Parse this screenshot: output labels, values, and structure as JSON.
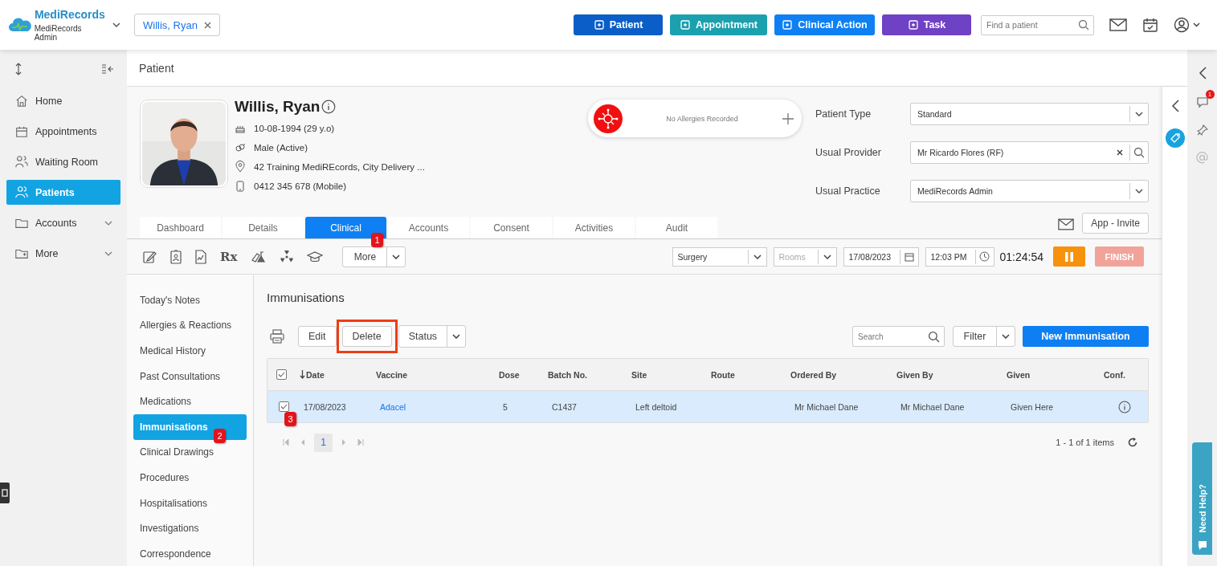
{
  "app": {
    "name": "MediRecords",
    "subtitle": "MediRecords Admin"
  },
  "open_patient": {
    "label": "Willis, Ryan"
  },
  "actions": [
    {
      "label": "Patient",
      "color": "#0b5ec7"
    },
    {
      "label": "Appointment",
      "color": "#1ba0ae"
    },
    {
      "label": "Clinical Action",
      "color": "#0e80f3"
    },
    {
      "label": "Task",
      "color": "#6f41c4"
    }
  ],
  "patient_search": {
    "placeholder": "Find a patient"
  },
  "sidebar": {
    "items": [
      {
        "label": "Home",
        "selected": false,
        "has_submenu": false
      },
      {
        "label": "Appointments",
        "selected": false,
        "has_submenu": false
      },
      {
        "label": "Waiting Room",
        "selected": false,
        "has_submenu": false
      },
      {
        "label": "Patients",
        "selected": true,
        "has_submenu": false
      },
      {
        "label": "Accounts",
        "selected": false,
        "has_submenu": true
      },
      {
        "label": "More",
        "selected": false,
        "has_submenu": true
      }
    ]
  },
  "page_title": "Patient",
  "patient": {
    "name": "Willis, Ryan",
    "dob": "10-08-1994 (29 y.o)",
    "gender": "Male (Active)",
    "address": "42 Training MediREcords, City Delivery ...",
    "phone": "0412 345 678 (Mobile)"
  },
  "allergies": {
    "text": "No Allergies Recorded"
  },
  "fields": [
    {
      "label": "Patient Type",
      "value": "Standard",
      "kind": "select"
    },
    {
      "label": "Usual Provider",
      "value": "Mr Ricardo Flores (RF)",
      "kind": "lookup"
    },
    {
      "label": "Usual Practice",
      "value": "MediRecords Admin",
      "kind": "select"
    }
  ],
  "app_invite": "App - Invite",
  "tabs": [
    {
      "label": "Dashboard",
      "selected": false
    },
    {
      "label": "Details",
      "selected": false
    },
    {
      "label": "Clinical",
      "selected": true,
      "marker": "1"
    },
    {
      "label": "Accounts",
      "selected": false
    },
    {
      "label": "Consent",
      "selected": false
    },
    {
      "label": "Activities",
      "selected": false
    },
    {
      "label": "Audit",
      "selected": false
    }
  ],
  "toolbar": {
    "rx": "Rx",
    "more": "More",
    "location": "Surgery",
    "rooms_placeholder": "Rooms",
    "date": "17/08/2023",
    "time": "12:03 PM",
    "timer": "01:24:54",
    "finish": {
      "label": "FINISH",
      "disabled": true
    }
  },
  "clinical_nav": [
    {
      "label": "Today's Notes",
      "selected": false
    },
    {
      "label": "Allergies & Reactions",
      "selected": false
    },
    {
      "label": "Medical History",
      "selected": false
    },
    {
      "label": "Past Consultations",
      "selected": false
    },
    {
      "label": "Medications",
      "selected": false
    },
    {
      "label": "Immunisations",
      "selected": true,
      "marker": "2"
    },
    {
      "label": "Clinical Drawings",
      "selected": false
    },
    {
      "label": "Procedures",
      "selected": false
    },
    {
      "label": "Hospitalisations",
      "selected": false
    },
    {
      "label": "Investigations",
      "selected": false
    },
    {
      "label": "Correspondence",
      "selected": false
    }
  ],
  "section_title": "Immunisations",
  "list_actions": [
    {
      "label": "Edit",
      "highlighted": false
    },
    {
      "label": "Delete",
      "highlighted": true
    },
    {
      "label": "Status",
      "highlighted": false
    }
  ],
  "table_search": {
    "placeholder": "Search"
  },
  "filter": "Filter",
  "new_button": "New Immunisation",
  "table": {
    "all_checked": true,
    "columns": [
      {
        "label": "Date",
        "sorted": true
      },
      {
        "label": "Vaccine",
        "sorted": false
      },
      {
        "label": "Dose",
        "sorted": false
      },
      {
        "label": "Batch No.",
        "sorted": false
      },
      {
        "label": "Site",
        "sorted": false
      },
      {
        "label": "Route",
        "sorted": false
      },
      {
        "label": "Ordered By",
        "sorted": false
      },
      {
        "label": "Given By",
        "sorted": false
      },
      {
        "label": "Given",
        "sorted": false
      },
      {
        "label": "Conf.",
        "sorted": false
      }
    ],
    "rows": [
      {
        "checked": true,
        "selected": true,
        "marker": "3",
        "cells": [
          "17/08/2023",
          "Adacel",
          "5",
          "C1437",
          "Left deltoid",
          "",
          "Mr Michael Dane",
          "Mr Michael Dane",
          "Given Here"
        ]
      }
    ]
  },
  "pagination": {
    "page": "1",
    "summary": "1 - 1 of 1 items"
  },
  "notification_count": "1",
  "help_tab": "Need Help?"
}
